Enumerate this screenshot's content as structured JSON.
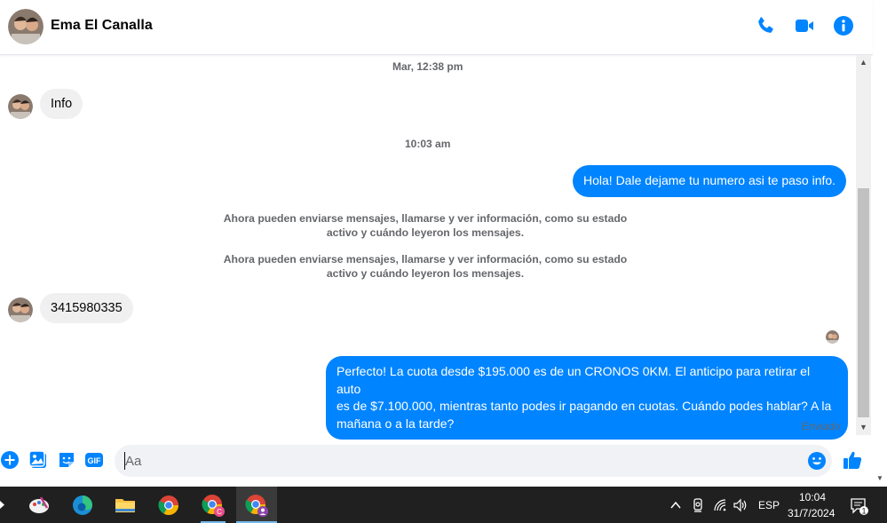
{
  "header": {
    "contact_name": "Ema El Canalla",
    "icons": [
      "phone-icon",
      "video-camera-icon",
      "info-icon"
    ]
  },
  "colors": {
    "accent": "#0084ff",
    "incoming_bubble": "#f0f0f0",
    "taskbar": "#202020"
  },
  "conversation": {
    "timestamp_1": "Mar, 12:38 pm",
    "incoming_1": "Info",
    "timestamp_2": "10:03 am",
    "outgoing_1": "Hola! Dale dejame tu numero  asi te paso info.",
    "system_1_line1": "Ahora pueden enviarse mensajes, llamarse y ver información, como su estado",
    "system_1_line2": "activo y cuándo leyeron los mensajes.",
    "system_2_line1": "Ahora pueden enviarse mensajes, llamarse y ver información, como su estado",
    "system_2_line2": "activo y cuándo leyeron los mensajes.",
    "incoming_2": "3415980335",
    "outgoing_2_line1": "Perfecto! La cuota desde $195.000 es de un CRONOS 0KM. El anticipo para retirar el auto",
    "outgoing_2_line2": "es de $7.100.000, mientras tanto podes ir pagando en cuotas. Cuándo podes hablar? A la",
    "outgoing_2_line3": "mañana o a la tarde?",
    "status": "Enviado"
  },
  "composer": {
    "placeholder": "Aa",
    "value": "",
    "gif_label": "GIF",
    "icons": [
      "plus-icon",
      "image-icon",
      "sticker-icon",
      "gif-icon",
      "emoji-icon",
      "thumbs-up-icon"
    ]
  },
  "taskbar": {
    "apps": [
      "paint-app",
      "edge-browser",
      "file-explorer",
      "chrome-browser",
      "chrome-profile-c",
      "chrome-profile-active"
    ],
    "language": "ESP",
    "time": "10:04",
    "date": "31/7/2024",
    "notification_count": "1"
  }
}
